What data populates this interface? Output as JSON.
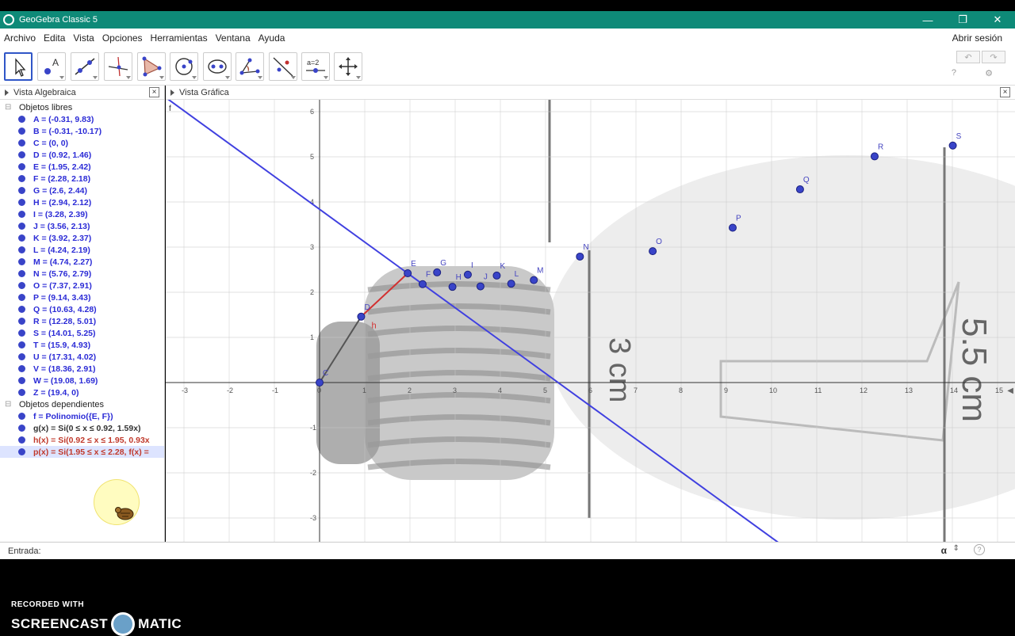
{
  "window": {
    "title": "GeoGebra Classic 5",
    "minimize": "—",
    "maximize": "❐",
    "close": "✕"
  },
  "menu": {
    "items": [
      "Archivo",
      "Edita",
      "Vista",
      "Opciones",
      "Herramientas",
      "Ventana",
      "Ayuda"
    ],
    "signin": "Abrir sesión"
  },
  "toolbar": {
    "tools": [
      "move-tool-icon",
      "point-tool-icon",
      "line-tool-icon",
      "perpendicular-tool-icon",
      "polygon-tool-icon",
      "circle-tool-icon",
      "conic-tool-icon",
      "angle-tool-icon",
      "reflect-tool-icon",
      "slider-tool-icon",
      "move-view-tool-icon"
    ],
    "slider_text": "a=2",
    "undo": "↶",
    "redo": "↷",
    "help": "?",
    "settings": "⚙"
  },
  "algebra": {
    "title": "Vista Algebraica",
    "free_label": "Objetos libres",
    "free": [
      "A = (-0.31, 9.83)",
      "B = (-0.31, -10.17)",
      "C = (0, 0)",
      "D = (0.92, 1.46)",
      "E = (1.95, 2.42)",
      "F = (2.28, 2.18)",
      "G = (2.6, 2.44)",
      "H = (2.94, 2.12)",
      "I = (3.28, 2.39)",
      "J = (3.56, 2.13)",
      "K = (3.92, 2.37)",
      "L = (4.24, 2.19)",
      "M = (4.74, 2.27)",
      "N = (5.76, 2.79)",
      "O = (7.37, 2.91)",
      "P = (9.14, 3.43)",
      "Q = (10.63, 4.28)",
      "R = (12.28, 5.01)",
      "S = (14.01, 5.25)",
      "T = (15.9, 4.93)",
      "U = (17.31, 4.02)",
      "V = (18.36, 2.91)",
      "W = (19.08, 1.69)",
      "Z = (19.4, 0)"
    ],
    "dependent_label": "Objetos dependientes",
    "dependent": [
      {
        "text": "f = Polinomio({E, F})",
        "style": "blue"
      },
      {
        "text": "g(x) = Si(0 ≤ x ≤ 0.92, 1.59x)",
        "style": "dark"
      },
      {
        "text": "h(x) = Si(0.92 ≤ x ≤ 1.95, 0.93x",
        "style": "red"
      },
      {
        "text": "p(x) = Si(1.95 ≤ x ≤ 2.28, f(x) =",
        "style": "red-sel"
      }
    ]
  },
  "graphics": {
    "title": "Vista Gráfica",
    "x_ticks": [
      "-3",
      "-2",
      "-1",
      "0",
      "1",
      "2",
      "3",
      "4",
      "5",
      "6",
      "7",
      "8",
      "9",
      "10",
      "11",
      "12",
      "13",
      "14",
      "15"
    ],
    "y_ticks": [
      "6",
      "5",
      "4",
      "3",
      "2",
      "1",
      "-1",
      "-2",
      "-3"
    ],
    "point_labels": [
      "C",
      "D",
      "E",
      "F",
      "G",
      "H",
      "I",
      "J",
      "K",
      "L",
      "M",
      "N",
      "O",
      "P",
      "Q",
      "R",
      "S"
    ],
    "curve_label_h": "h",
    "corner_label": "f",
    "photo_text_1": "3 cm",
    "photo_text_2": "5.5 cm"
  },
  "input_bar": {
    "label": "Entrada:",
    "value": "",
    "alpha": "α",
    "arrows": "⇕",
    "help": "?"
  },
  "watermark": {
    "line1": "RECORDED WITH",
    "line2a": "SCREENCAST",
    "line2b": "MATIC"
  },
  "colors": {
    "titlebar": "#0e8a78",
    "point": "#3944c8",
    "line_f": "#4040e0",
    "segment_h": "#d23030"
  }
}
